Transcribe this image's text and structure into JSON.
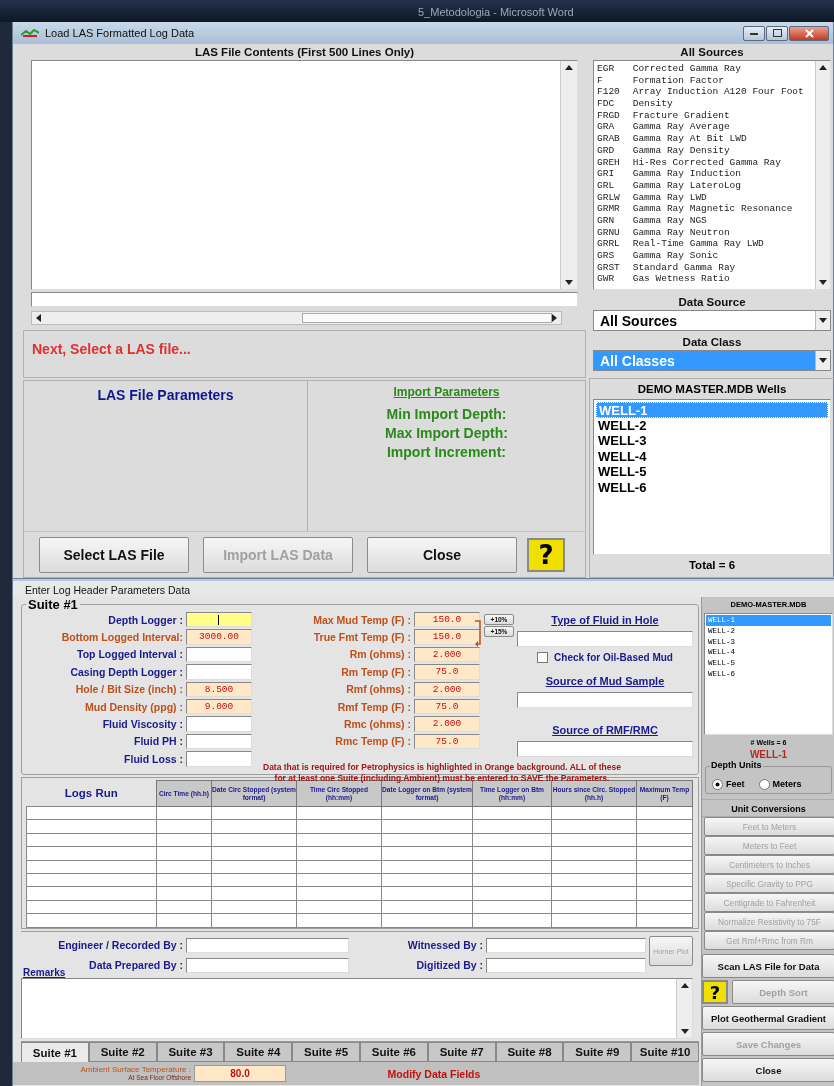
{
  "background_window": {
    "title": "5_Metodologia - Microsoft Word"
  },
  "load_window": {
    "title": "Load  LAS  Formatted  Log  Data",
    "contents_heading": "LAS File Contents (First 500 Lines Only)",
    "status": "Next, Select a LAS file...",
    "parameters_heading": "LAS File Parameters",
    "import_heading": "Import Parameters",
    "import_labels": [
      "Min Import Depth:",
      "Max Import Depth:",
      "Import Increment:"
    ],
    "buttons": [
      {
        "label": "Select LAS File",
        "disabled": false
      },
      {
        "label": "Import LAS Data",
        "disabled": true
      },
      {
        "label": "Close",
        "disabled": false
      }
    ],
    "help_button": "?",
    "sources_heading": "All Sources",
    "sources": [
      {
        "code": "EGR",
        "name": "Corrected Gamma Ray"
      },
      {
        "code": "F",
        "name": "Formation Factor"
      },
      {
        "code": "F120",
        "name": "Array Induction A120 Four Foot"
      },
      {
        "code": "FDC",
        "name": "Density"
      },
      {
        "code": "FRGD",
        "name": "Fracture Gradient"
      },
      {
        "code": "GRA",
        "name": "Gamma Ray Average"
      },
      {
        "code": "GRAB",
        "name": "Gamma Ray At Bit LWD"
      },
      {
        "code": "GRD",
        "name": "Gamma Ray Density"
      },
      {
        "code": "GREH",
        "name": "Hi-Res Corrected Gamma Ray"
      },
      {
        "code": "GRI",
        "name": "Gamma Ray Induction"
      },
      {
        "code": "GRL",
        "name": "Gamma Ray LateroLog"
      },
      {
        "code": "GRLW",
        "name": "Gamma Ray LWD"
      },
      {
        "code": "GRMR",
        "name": "Gamma Ray Magnetic Resonance"
      },
      {
        "code": "GRN",
        "name": "Gamma Ray NGS"
      },
      {
        "code": "GRNU",
        "name": "Gamma Ray Neutron"
      },
      {
        "code": "GRRL",
        "name": "Real-Time Gamma Ray LWD"
      },
      {
        "code": "GRS",
        "name": "Gamma Ray Sonic"
      },
      {
        "code": "GRST",
        "name": "Standard Gamma Ray"
      },
      {
        "code": "GWR",
        "name": "Gas Wetness Ratio"
      }
    ],
    "data_source": {
      "label": "Data Source",
      "value": "All Sources",
      "highlighted": false
    },
    "data_class": {
      "label": "Data Class",
      "value": "All Classes",
      "highlighted": true
    },
    "wells_heading": "DEMO MASTER.MDB  Wells",
    "wells": [
      {
        "name": "WELL-1",
        "selected": true
      },
      {
        "name": "WELL-2",
        "selected": false
      },
      {
        "name": "WELL-3",
        "selected": false
      },
      {
        "name": "WELL-4",
        "selected": false
      },
      {
        "name": "WELL-5",
        "selected": false
      },
      {
        "name": "WELL-6",
        "selected": false
      }
    ],
    "total": "Total = 6"
  },
  "header_window": {
    "title": "Enter  Log  Header  Parameters  Data",
    "suite_title": "Suite #1",
    "left_fields": [
      {
        "label": "Depth Logger :",
        "required": false,
        "focused": true
      },
      {
        "label": "Bottom Logged Interval:",
        "value": "3000.00",
        "required": true,
        "focused": false
      },
      {
        "label": "Top Logged Interval :",
        "required": false,
        "focused": false
      },
      {
        "label": "Casing Depth Logger :",
        "required": false,
        "focused": false
      },
      {
        "label": "Hole / Bit Size (inch) :",
        "value": "8.500",
        "required": true,
        "focused": false
      },
      {
        "label": "Mud Density (ppg) :",
        "value": "9.000",
        "required": true,
        "focused": false
      },
      {
        "label": "Fluid Viscosity :",
        "required": false,
        "focused": false
      },
      {
        "label": "Fluid PH :",
        "required": false,
        "focused": false
      },
      {
        "label": "Fluid Loss :",
        "required": false,
        "focused": false
      }
    ],
    "temp_fields": [
      {
        "label": "Max Mud Temp (F) :",
        "value": "150.0",
        "required": true
      },
      {
        "label": "True Fmt Temp (F) :",
        "value": "150.0",
        "required": true
      },
      {
        "label": "Rm (ohms) :",
        "value": "2.000",
        "required": true
      },
      {
        "label": "Rm Temp (F) :",
        "value": "75.0",
        "required": true
      },
      {
        "label": "Rmf (ohms) :",
        "value": "2.000",
        "required": true
      },
      {
        "label": "Rmf Temp (F) :",
        "value": "75.0",
        "required": true
      },
      {
        "label": "Rmc (ohms) :",
        "value": "2.000",
        "required": true
      },
      {
        "label": "Rmc Temp (F) :",
        "value": "75.0",
        "required": true
      }
    ],
    "temp_buttons": [
      "+10%",
      "+15%"
    ],
    "fluid_type_label": "Type of Fluid in Hole",
    "oil_based": {
      "label": "Check for Oil-Based Mud",
      "checked": false
    },
    "mud_source_label": "Source of Mud Sample",
    "rmf_source_label": "Source of RMF/RMC",
    "note": "Data that is required for Petrophysics is highlighted in Orange background. ALL of these for at least one Suite (including Ambient) must be entered to SAVE the Parameters.",
    "logs_table": {
      "columns": [
        "Logs Run",
        "Circ Time (hh.h)",
        "Date Circ Stopped (system format)",
        "Time Circ Stopped (hh:mm)",
        "Date Logger on Btm (system format)",
        "Time Logger on Btm (hh:mm)",
        "Hours since Circ. Stopped (hh.h)",
        "Maximum Temp (F)"
      ]
    },
    "signatures": [
      {
        "label": "Engineer / Recorded By :"
      },
      {
        "label": "Witnessed By :"
      },
      {
        "label": "Data Prepared By :"
      },
      {
        "label": "Digitized By :"
      }
    ],
    "horner_button": {
      "label": "Horner Plot",
      "disabled": true
    },
    "remarks_label": "Remarks",
    "suite_tabs": [
      {
        "label": "Suite #1",
        "selected": true
      },
      {
        "label": "Suite #2",
        "selected": false
      },
      {
        "label": "Suite #3",
        "selected": false
      },
      {
        "label": "Suite #4",
        "selected": false
      },
      {
        "label": "Suite #5",
        "selected": false
      },
      {
        "label": "Suite #6",
        "selected": false
      },
      {
        "label": "Suite #7",
        "selected": false
      },
      {
        "label": "Suite #8",
        "selected": false
      },
      {
        "label": "Suite #9",
        "selected": false
      },
      {
        "label": "Suite #10",
        "selected": false
      }
    ],
    "ambient": {
      "label": "Ambient Surface Temperature :",
      "sublabel": "At Sea Floor Offshore",
      "value": "80.0"
    },
    "status": "Modify Data Fields",
    "db_heading": "DEMO-MASTER.MDB",
    "wells": [
      {
        "name": "WELL-1",
        "selected": true
      },
      {
        "name": "WELL-2",
        "selected": false
      },
      {
        "name": "WELL-3",
        "selected": false
      },
      {
        "name": "WELL-4",
        "selected": false
      },
      {
        "name": "WELL-5",
        "selected": false
      },
      {
        "name": "WELL-6",
        "selected": false
      }
    ],
    "well_count": "# Wells = 6",
    "current_well": "WELL-1",
    "depth_units": {
      "label": "Depth Units",
      "options": [
        {
          "label": "Feet",
          "selected": true
        },
        {
          "label": "Meters",
          "selected": false
        }
      ]
    },
    "conversions_heading": "Unit Conversions",
    "conversions": [
      {
        "label": "Feet to Meters",
        "disabled": true
      },
      {
        "label": "Meters to Feet",
        "disabled": true
      },
      {
        "label": "Centimeters to Inches",
        "disabled": true
      },
      {
        "label": "Specific Gravity to PPG",
        "disabled": true
      },
      {
        "label": "Centigrade to Fahrenheit",
        "disabled": true
      },
      {
        "label": "Normalize Resistivity to 75F",
        "disabled": true
      },
      {
        "label": "Get Rmf+Rmc from Rm",
        "disabled": true
      }
    ],
    "actions": [
      {
        "kind": "button",
        "label": "Scan LAS File for Data",
        "disabled": false
      },
      {
        "kind": "help",
        "label": "?",
        "disabled": false
      },
      {
        "kind": "button",
        "label": "Depth Sort",
        "disabled": true
      },
      {
        "kind": "button",
        "label": "Plot Geothermal Gradient",
        "disabled": false
      },
      {
        "kind": "button",
        "label": "Save Changes",
        "disabled": true
      },
      {
        "kind": "button",
        "label": "Close",
        "disabled": false
      }
    ]
  }
}
